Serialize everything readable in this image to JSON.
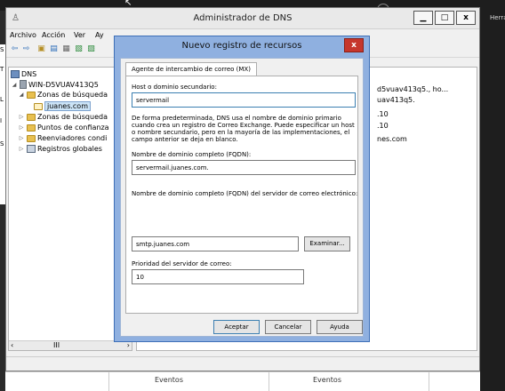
{
  "dns_window": {
    "title": "Administrador de DNS",
    "controls": {
      "minimize": "▁",
      "maximize": "□",
      "close": "x"
    },
    "menu": [
      "Archivo",
      "Acción",
      "Ver",
      "Ay"
    ]
  },
  "tree": {
    "items": [
      {
        "label": "DNS"
      },
      {
        "label": "WIN-D5VUAV413Q5"
      },
      {
        "label": "Zonas de búsqueda"
      },
      {
        "label": "juanes.com"
      },
      {
        "label": "Zonas de búsqueda"
      },
      {
        "label": "Puntos de confianza"
      },
      {
        "label": "Reenviadores condi"
      },
      {
        "label": "Registros globales"
      }
    ],
    "scroll_thumb": "III"
  },
  "list": {
    "rows": [
      "d5vuav413q5., ho...",
      "uav413q5.",
      ".10",
      ".10",
      "nes.com"
    ]
  },
  "bottom": {
    "events_left": "Eventos",
    "events_right": "Eventos"
  },
  "right_panel": {
    "label": "Herra"
  },
  "left_letters": [
    "S",
    "T",
    "L",
    "I",
    "S"
  ],
  "dialog": {
    "title": "Nuevo registro de recursos",
    "close": "x",
    "tab": "Agente de intercambio de correo (MX)",
    "host_label": "Host o dominio secundario:",
    "host_value": "servermail",
    "description": "De forma predeterminada, DNS usa el nombre de dominio primario cuando crea un registro de Correo Exchange. Puede especificar un host o nombre secundario, pero en la mayoría de las implementaciones, el campo anterior se deja en blanco.",
    "fqdn_label": "Nombre de dominio completo (FQDN):",
    "fqdn_value": "servermail.juanes.com.",
    "mail_server_label": "Nombre de dominio completo (FQDN) del servidor de correo electrónico:",
    "mail_server_value": "smtp.juanes.com",
    "browse": "Examinar...",
    "priority_label": "Prioridad del servidor de correo:",
    "priority_value": "10",
    "buttons": {
      "ok": "Aceptar",
      "cancel": "Cancelar",
      "help": "Ayuda"
    }
  },
  "colors": {
    "dialog_frame": "#8fb0e0",
    "close_button": "#c6362c",
    "selection": "#cce4f7"
  }
}
